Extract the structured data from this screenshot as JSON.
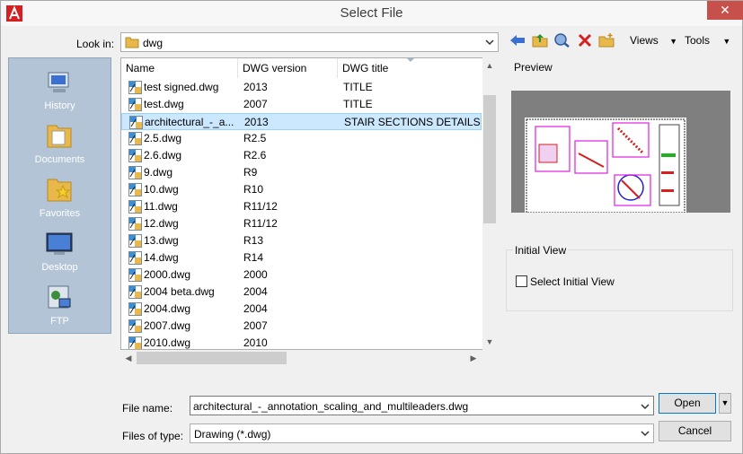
{
  "window": {
    "title": "Select File",
    "close": "✕"
  },
  "lookin": {
    "label": "Look in:",
    "value": "dwg"
  },
  "toolbar": {
    "views": "Views",
    "tools": "Tools"
  },
  "places": [
    {
      "label": "History"
    },
    {
      "label": "Documents"
    },
    {
      "label": "Favorites"
    },
    {
      "label": "Desktop"
    },
    {
      "label": "FTP"
    }
  ],
  "columns": [
    "Name",
    "DWG version",
    "DWG title"
  ],
  "files": [
    {
      "name": "test signed.dwg",
      "version": "2013",
      "title": "TITLE"
    },
    {
      "name": "test.dwg",
      "version": "2007",
      "title": "TITLE"
    },
    {
      "name": "architectural_-_a...",
      "version": "2013",
      "title": "STAIR SECTIONS DETAILS"
    },
    {
      "name": "2.5.dwg",
      "version": "R2.5",
      "title": ""
    },
    {
      "name": "2.6.dwg",
      "version": "R2.6",
      "title": ""
    },
    {
      "name": "9.dwg",
      "version": "R9",
      "title": ""
    },
    {
      "name": "10.dwg",
      "version": "R10",
      "title": ""
    },
    {
      "name": "11.dwg",
      "version": "R11/12",
      "title": ""
    },
    {
      "name": "12.dwg",
      "version": "R11/12",
      "title": ""
    },
    {
      "name": "13.dwg",
      "version": "R13",
      "title": ""
    },
    {
      "name": "14.dwg",
      "version": "R14",
      "title": ""
    },
    {
      "name": "2000.dwg",
      "version": "2000",
      "title": ""
    },
    {
      "name": "2004 beta.dwg",
      "version": "2004",
      "title": ""
    },
    {
      "name": "2004.dwg",
      "version": "2004",
      "title": ""
    },
    {
      "name": "2007.dwg",
      "version": "2007",
      "title": ""
    },
    {
      "name": "2010.dwg",
      "version": "2010",
      "title": ""
    }
  ],
  "selected_index": 2,
  "preview": {
    "label": "Preview"
  },
  "initial_view": {
    "group_label": "Initial View",
    "checkbox_label": "Select Initial View",
    "checked": false
  },
  "filename": {
    "label": "File name:",
    "value": "architectural_-_annotation_scaling_and_multileaders.dwg"
  },
  "filetype": {
    "label": "Files of type:",
    "value": "Drawing (*.dwg)"
  },
  "buttons": {
    "open": "Open",
    "cancel": "Cancel"
  },
  "colors": {
    "selection": "#cce8ff",
    "sidebar": "#b3c4d6",
    "close": "#c7504a",
    "preview_bg": "#7f7f7f"
  }
}
